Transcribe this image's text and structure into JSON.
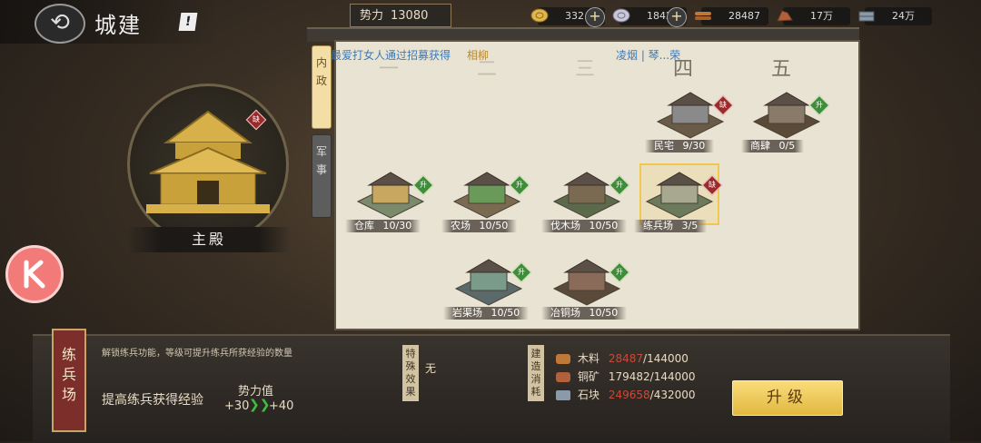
{
  "header": {
    "title": "城建",
    "warning_mark": "!"
  },
  "topbar": {
    "power_label": "势力",
    "power_value": "13080",
    "resources": [
      {
        "icon": "gold-coin-icon",
        "value": "332",
        "has_plus": true
      },
      {
        "icon": "silver-coin-icon",
        "value": "1842",
        "has_plus": true
      },
      {
        "icon": "wood-icon",
        "value": "28487",
        "has_plus": false
      },
      {
        "icon": "copper-ore-icon",
        "value": "17万",
        "has_plus": false
      },
      {
        "icon": "stone-icon",
        "value": "24万",
        "has_plus": false
      }
    ],
    "plus_symbol": "+"
  },
  "palace": {
    "name": "主殿",
    "level_mark": "八",
    "badge": "缺"
  },
  "tabs": [
    {
      "label": "内政",
      "active": true
    },
    {
      "label": "军事",
      "active": false
    }
  ],
  "ticker": {
    "part1": "最爱打女人通过招募获得",
    "part2": "相柳",
    "part3": "凌烟 | 琴...荣"
  },
  "columns": [
    "一",
    "二",
    "三",
    "四",
    "五"
  ],
  "buildings": [
    {
      "name": "民宅",
      "progress": "9/30",
      "badge": "缺",
      "badge_type": "lock"
    },
    {
      "name": "商肆",
      "progress": "0/5",
      "badge": "升",
      "badge_type": "up"
    },
    {
      "name": "仓库",
      "progress": "10/30",
      "badge": "升",
      "badge_type": "up"
    },
    {
      "name": "农场",
      "progress": "10/50",
      "badge": "升",
      "badge_type": "up"
    },
    {
      "name": "伐木场",
      "progress": "10/50",
      "badge": "升",
      "badge_type": "up"
    },
    {
      "name": "练兵场",
      "progress": "3/5",
      "badge": "缺",
      "badge_type": "lock"
    },
    {
      "name": "岩渠场",
      "progress": "10/50",
      "badge": "升",
      "badge_type": "up"
    },
    {
      "name": "冶铜场",
      "progress": "10/50",
      "badge": "升",
      "badge_type": "up"
    }
  ],
  "detail": {
    "building_name": "练兵场",
    "description": "解锁练兵功能，等级可提升练兵所获经验的数量",
    "feature": "提高练兵获得经验",
    "power_label": "势力值",
    "power_from": "+30",
    "power_to": "+40",
    "special_label": "特殊效果",
    "special_value": "无",
    "cost_label": "建造消耗",
    "costs": [
      {
        "name": "木料",
        "have": "28487",
        "need": "/144000",
        "short": true,
        "color": "#c07838"
      },
      {
        "name": "铜矿",
        "have": "179482",
        "need": "/144000",
        "short": false,
        "color": "#b0603a"
      },
      {
        "name": "石块",
        "have": "249658",
        "need": "/432000",
        "short": true,
        "color": "#8a9aa8"
      }
    ],
    "upgrade_label": "升级"
  },
  "colors": {
    "accent_gold": "#e2b840",
    "shortage_red": "#c94a3a",
    "panel_bg": "#e9e3d3"
  }
}
